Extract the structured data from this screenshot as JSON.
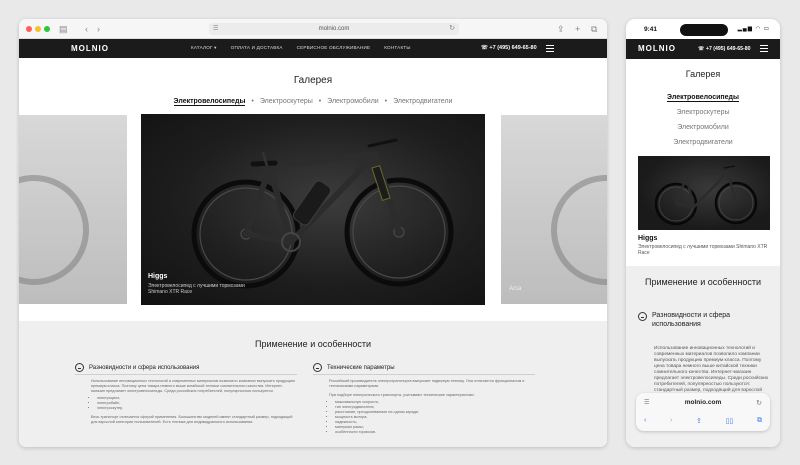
{
  "browser": {
    "url": "molnio.com",
    "icons": {
      "sidebar": "sidebar-icon",
      "back": "‹",
      "forward": "›",
      "reload": "↻",
      "share": "⇪",
      "plus": "+",
      "tabs": "⧉"
    }
  },
  "site": {
    "logo": "MOLNIO",
    "menu": [
      "КАТАЛОГ ▾",
      "ОПЛАТА И ДОСТАВКА",
      "СЕРВИСНОЕ ОБСЛУЖИВАНИЕ",
      "КОНТАКТЫ"
    ],
    "phone": "☏ +7 (495) 649-65-80"
  },
  "gallery": {
    "title": "Галерея",
    "categories": [
      "Электровелосипеды",
      "Электроскутеры",
      "Электромобили",
      "Электродвигатели"
    ],
    "separator": "•",
    "active_index": 0,
    "slide": {
      "title": "Higgs",
      "description": "Электровелосипед с лучшими тормозами Shimano XTR Race"
    },
    "next_caption": "Arca"
  },
  "features": {
    "title": "Применение и особенности",
    "left": {
      "heading": "Разновидности и сфера использования",
      "p1": "Использование инновационных технологий и современных материалов позволило компании выпускать продукцию премиум класса. Поэтому цена товара немного выше китайской техники сомнительного качества. Интернет-магазин предлагает электровелосипеды. Среди российских потребителей, популярностью пользуются:",
      "items": [
        "электроцикл;",
        "электробайк;",
        "электроскутер."
      ],
      "p2": "Весь транспорт отличается сферой применения. Большинство моделей имеют стандартный размер, подходящий для взрослой категории пользователей. Есть техника для индивидуального использования."
    },
    "right": {
      "heading": "Технические параметры",
      "p1": "Российский производитель электротранспорта выпускает надежную технику. Она отличается функционалом и техническими параметрами.",
      "p2": "При подборе электрического транспорта, учитывают технические характеристики:",
      "items": [
        "максимальную скорость;",
        "тип электродвигателя;",
        "расстояние, преодолеваемое на одном заряде;",
        "мощность мотора;",
        "надежность;",
        "материал рамы;",
        "особенности тормозов."
      ]
    }
  },
  "mobile": {
    "time": "9:41",
    "status_icons": "▂▄▆ ◠ ▭",
    "phone": "☏ +7 (495) 649-65-80",
    "features_title": "Применение и особенности",
    "left_heading": "Разновидности и сфера использования",
    "text": "Использование инновационных технологий и современных материалов позволило компании выпускать продукцию премиум класса. Поэтому цена товара немного выше китайской техники сомнительного качества. Интернет-магазин предлагает электровелосипеды. Среди российских потребителей, популярностью пользуются: стандартный размер, подходящий для взрослой категории пользователей.",
    "url": "molnio.com",
    "tools": [
      "‹",
      "›",
      "⇪",
      "▯▯",
      "⧉"
    ]
  }
}
